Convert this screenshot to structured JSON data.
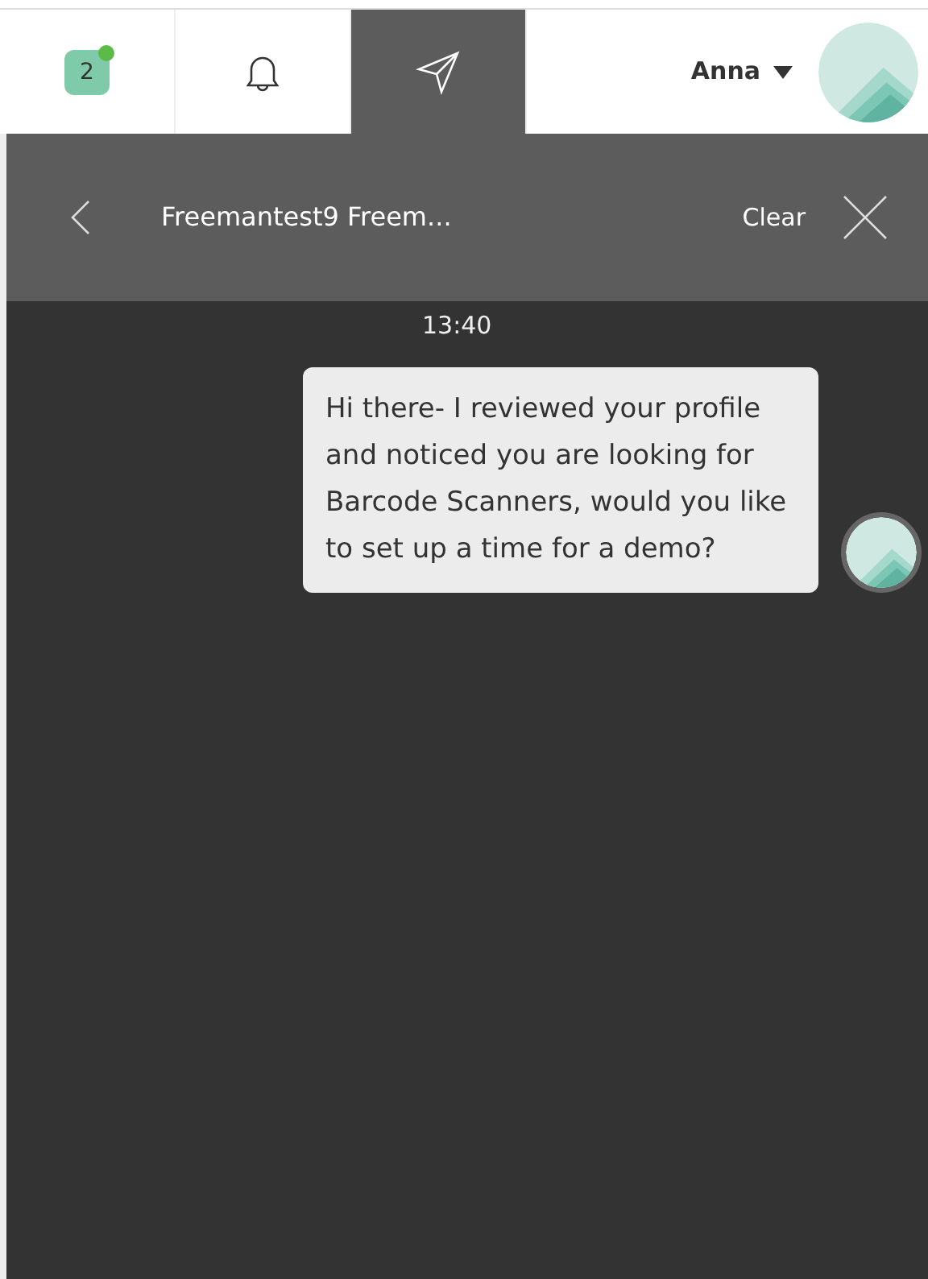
{
  "nav": {
    "tabs": [
      {
        "kind": "badge",
        "count": "2",
        "dot": true,
        "selected": false
      },
      {
        "kind": "bell",
        "selected": false
      },
      {
        "kind": "send",
        "selected": true
      }
    ],
    "user": {
      "name": "Anna"
    }
  },
  "header": {
    "title": "Freemantest9 Freem...",
    "clear": "Clear"
  },
  "messages": [
    {
      "time": "13:40",
      "text": "Hi there- I reviewed your profile and noticed you are looking for Barcode Scanners, would you like to set up a time for a demo?"
    }
  ]
}
